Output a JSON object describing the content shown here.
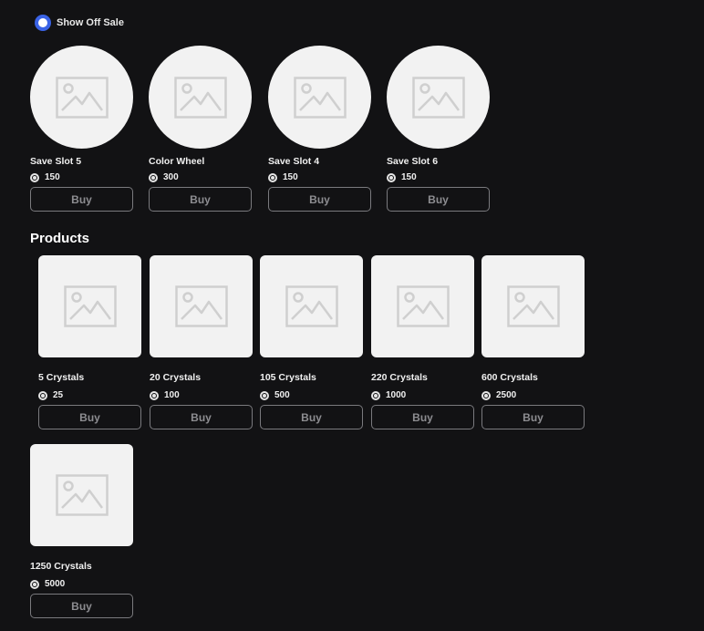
{
  "filter": {
    "show_off_sale_label": "Show Off Sale",
    "show_off_sale_checked": true
  },
  "offsale_items": [
    {
      "name": "Save Slot 5",
      "price": "150",
      "buy_label": "Buy",
      "icon": "image-placeholder-icon"
    },
    {
      "name": "Color Wheel",
      "price": "300",
      "buy_label": "Buy",
      "icon": "image-placeholder-icon"
    },
    {
      "name": "Save Slot 4",
      "price": "150",
      "buy_label": "Buy",
      "icon": "image-placeholder-icon"
    },
    {
      "name": "Save Slot 6",
      "price": "150",
      "buy_label": "Buy",
      "icon": "image-placeholder-icon"
    }
  ],
  "products": {
    "title": "Products",
    "items": [
      {
        "name": "5 Crystals",
        "price": "25",
        "buy_label": "Buy",
        "icon": "image-placeholder-icon"
      },
      {
        "name": "20 Crystals",
        "price": "100",
        "buy_label": "Buy",
        "icon": "image-placeholder-icon"
      },
      {
        "name": "105 Crystals",
        "price": "500",
        "buy_label": "Buy",
        "icon": "image-placeholder-icon"
      },
      {
        "name": "220 Crystals",
        "price": "1000",
        "buy_label": "Buy",
        "icon": "image-placeholder-icon"
      },
      {
        "name": "600 Crystals",
        "price": "2500",
        "buy_label": "Buy",
        "icon": "image-placeholder-icon"
      },
      {
        "name": "1250 Crystals",
        "price": "5000",
        "buy_label": "Buy",
        "icon": "image-placeholder-icon"
      }
    ]
  },
  "colors": {
    "background": "#121214",
    "toggle_accent": "#3a63e6",
    "placeholder_bg": "#f2f2f2",
    "button_border": "#7a7a7e",
    "button_text": "#8d8d91"
  },
  "currency_icon": "robux-coin-icon"
}
